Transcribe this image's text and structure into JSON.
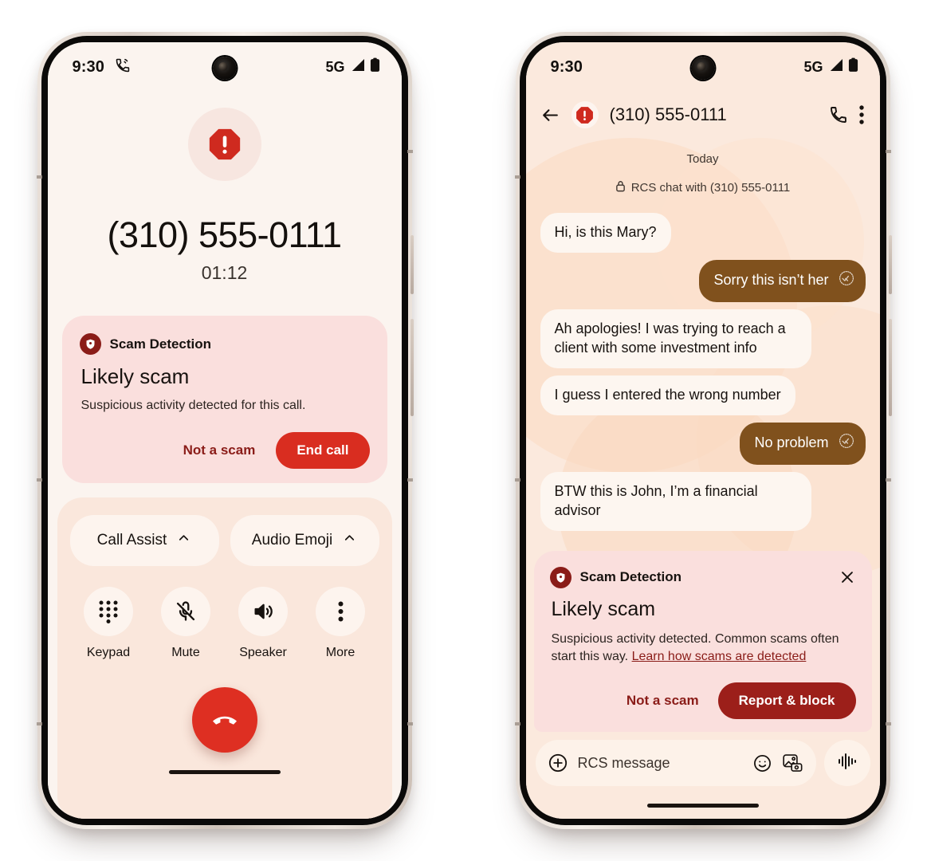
{
  "phone_call": {
    "status_bar": {
      "time": "9:30",
      "call_icon": "phone-in-talk-icon",
      "network": "5G",
      "signal_icon": "signal-bars-icon",
      "battery_icon": "battery-full-icon"
    },
    "avatar_icon": "scam-octagon-alert-icon",
    "number": "(310) 555-0111",
    "timer": "01:12",
    "scam_card": {
      "badge_icon": "shield-alert-icon",
      "header": "Scam Detection",
      "title": "Likely scam",
      "description": "Suspicious activity detected for this call.",
      "secondary_action": "Not a scam",
      "primary_action": "End call"
    },
    "assist_buttons": [
      {
        "label": "Call Assist",
        "icon": "chevron-up-icon"
      },
      {
        "label": "Audio Emoji",
        "icon": "chevron-up-icon"
      }
    ],
    "controls": [
      {
        "label": "Keypad",
        "icon": "dialpad-icon"
      },
      {
        "label": "Mute",
        "icon": "mic-off-icon"
      },
      {
        "label": "Speaker",
        "icon": "speaker-icon"
      },
      {
        "label": "More",
        "icon": "more-vert-icon"
      }
    ],
    "end_call_icon": "call-end-icon"
  },
  "phone_messages": {
    "status_bar": {
      "time": "9:30",
      "network": "5G",
      "signal_icon": "signal-bars-icon",
      "battery_icon": "battery-full-icon"
    },
    "appbar": {
      "back_icon": "arrow-back-icon",
      "avatar_icon": "scam-octagon-alert-icon",
      "title": "(310) 555-0111",
      "call_icon": "phone-icon",
      "menu_icon": "more-vert-icon"
    },
    "day_label": "Today",
    "rcs_note": {
      "lock_icon": "lock-icon",
      "text": "RCS chat with (310) 555-0111"
    },
    "messages": [
      {
        "side": "in",
        "text": "Hi, is this Mary?"
      },
      {
        "side": "out",
        "text": "Sorry this isn’t her",
        "status_icon": "double-check-icon"
      },
      {
        "side": "in",
        "text": "Ah apologies! I was trying to reach a client with some investment info"
      },
      {
        "side": "in",
        "text": "I guess I entered the wrong number"
      },
      {
        "side": "out",
        "text": "No problem",
        "status_icon": "double-check-icon"
      },
      {
        "side": "in",
        "text": "BTW this is John, I’m a financial advisor"
      }
    ],
    "scam_card": {
      "badge_icon": "shield-alert-icon",
      "header": "Scam Detection",
      "close_icon": "close-icon",
      "title": "Likely scam",
      "description": "Suspicious activity detected. Common scams often start this way. ",
      "link": "Learn how scams are detected",
      "secondary_action": "Not a scam",
      "primary_action": "Report & block"
    },
    "composer": {
      "add_icon": "plus-circle-icon",
      "placeholder": "RCS message",
      "emoji_icon": "emoji-smile-icon",
      "gallery_icon": "image-camera-icon",
      "mic_icon": "audio-waveform-icon"
    }
  },
  "colors": {
    "scam_red": "#8a1c18",
    "end_call_red": "#d92d20",
    "report_block_red": "#9c1f1a",
    "scam_card_bg": "#fadfdd",
    "out_bubble": "#80511d",
    "in_bubble": "#fdf6f0",
    "call_bg": "#fbf4ef",
    "controls_bg": "#fae7dc",
    "messages_bg": "#fbe9dd"
  }
}
